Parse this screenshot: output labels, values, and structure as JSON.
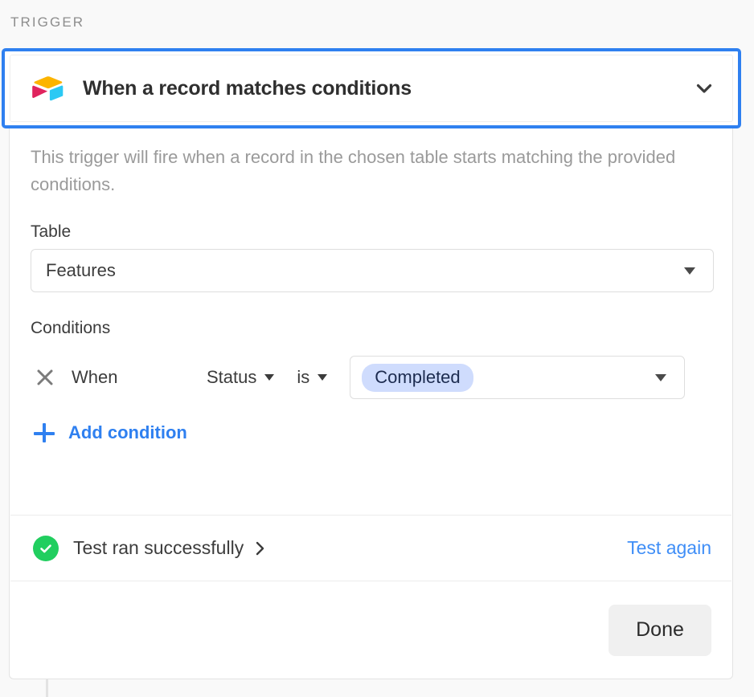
{
  "section": {
    "label": "TRIGGER"
  },
  "trigger": {
    "icon": "airtable-logo-icon",
    "title": "When a record matches conditions",
    "collapse_icon": "chevron-down-icon",
    "description": "This trigger will fire when a record in the chosen table starts matching the provided conditions."
  },
  "table_field": {
    "label": "Table",
    "value": "Features",
    "caret_icon": "caret-down-icon"
  },
  "conditions": {
    "label": "Conditions",
    "rows": [
      {
        "remove_icon": "close-icon",
        "prefix": "When",
        "field": "Status",
        "field_caret_icon": "caret-down-icon",
        "operator": "is",
        "operator_caret_icon": "caret-down-icon",
        "value": "Completed",
        "value_caret_icon": "caret-down-icon"
      }
    ],
    "add_label": "Add condition",
    "add_icon": "plus-icon"
  },
  "test": {
    "status_icon": "check-circle-icon",
    "status_text": "Test ran successfully",
    "status_chevron_icon": "chevron-right-icon",
    "retry_label": "Test again"
  },
  "footer": {
    "done_label": "Done"
  },
  "colors": {
    "focus_border": "#2f80f0",
    "link": "#2f80f0",
    "test_link": "#3f8ef7",
    "success": "#21ce5f",
    "pill_bg": "#cfdcfd",
    "pill_text": "#1c2b4f",
    "page_bg": "#f9f9f9",
    "card_border": "#e3e3e3",
    "done_bg": "#f0f0f0",
    "airtable_yellow": "#fcb400",
    "airtable_pink": "#e0245e",
    "airtable_blue": "#2bc9f4"
  }
}
